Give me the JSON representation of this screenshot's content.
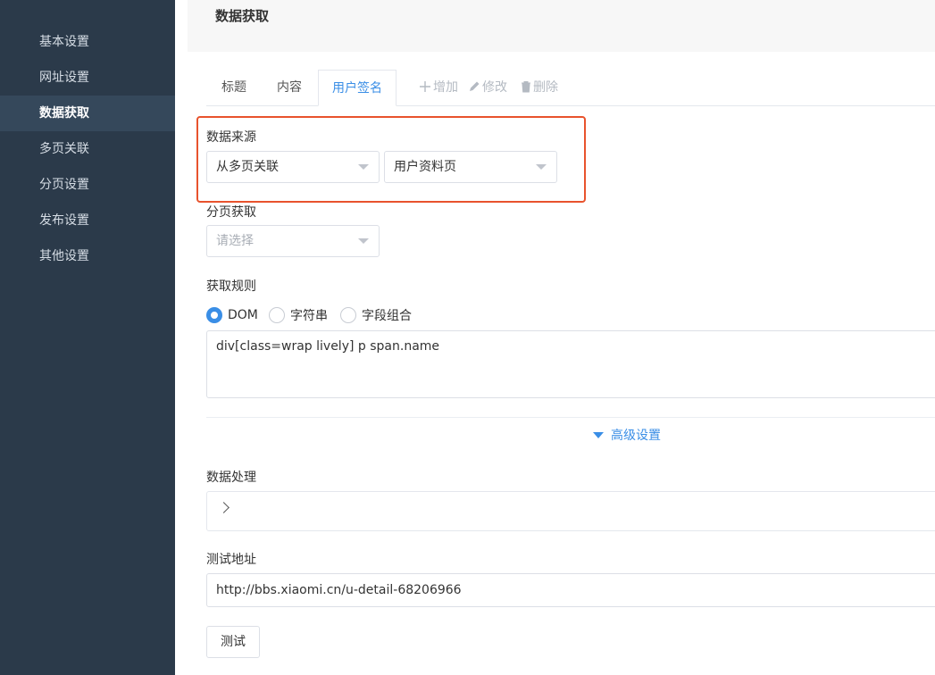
{
  "sidebar": {
    "items": [
      {
        "label": "基本设置"
      },
      {
        "label": "网址设置"
      },
      {
        "label": "数据获取"
      },
      {
        "label": "多页关联"
      },
      {
        "label": "分页设置"
      },
      {
        "label": "发布设置"
      },
      {
        "label": "其他设置"
      }
    ],
    "active_index": 2
  },
  "header": {
    "title": "数据获取"
  },
  "tabs": {
    "items": [
      {
        "label": "标题"
      },
      {
        "label": "内容"
      },
      {
        "label": "用户签名"
      }
    ],
    "active": "用户签名",
    "actions": {
      "add": "增加",
      "edit": "修改",
      "delete": "删除"
    }
  },
  "data_source": {
    "label": "数据来源",
    "select1": "从多页关联",
    "select2": "用户资料页"
  },
  "pagination": {
    "label": "分页获取",
    "placeholder": "请选择"
  },
  "rule": {
    "label": "获取规则",
    "options": [
      "DOM",
      "字符串",
      "字段组合"
    ],
    "selected": "DOM",
    "value": "div[class=wrap lively] p span.name"
  },
  "advanced": {
    "label": "高级设置"
  },
  "processing": {
    "label": "数据处理"
  },
  "test": {
    "label": "测试地址",
    "url": "http://bbs.xiaomi.cn/u-detail-68206966",
    "button": "测试"
  },
  "colors": {
    "sidebar_bg": "#2b3a4a",
    "accent": "#3a8ee6",
    "highlight": "#e8532d"
  }
}
